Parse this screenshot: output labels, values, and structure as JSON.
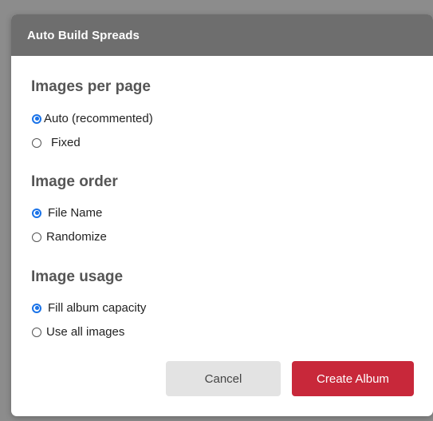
{
  "dialog": {
    "title": "Auto Build Spreads"
  },
  "sections": [
    {
      "title": "Images per page",
      "options": [
        {
          "label": "Auto (recommented)",
          "checked": true
        },
        {
          "label": "Fixed",
          "checked": false
        }
      ]
    },
    {
      "title": "Image order",
      "options": [
        {
          "label": "File Name",
          "checked": true
        },
        {
          "label": "Randomize",
          "checked": false
        }
      ]
    },
    {
      "title": "Image usage",
      "options": [
        {
          "label": "Fill album capacity",
          "checked": true
        },
        {
          "label": "Use all images",
          "checked": false
        }
      ]
    }
  ],
  "buttons": {
    "cancel_label": "Cancel",
    "create_label": "Create Album"
  },
  "colors": {
    "header_bg": "#6e6e6e",
    "accent": "#1a73e8",
    "primary_button": "#c8283a",
    "secondary_button": "#e3e3e3"
  }
}
